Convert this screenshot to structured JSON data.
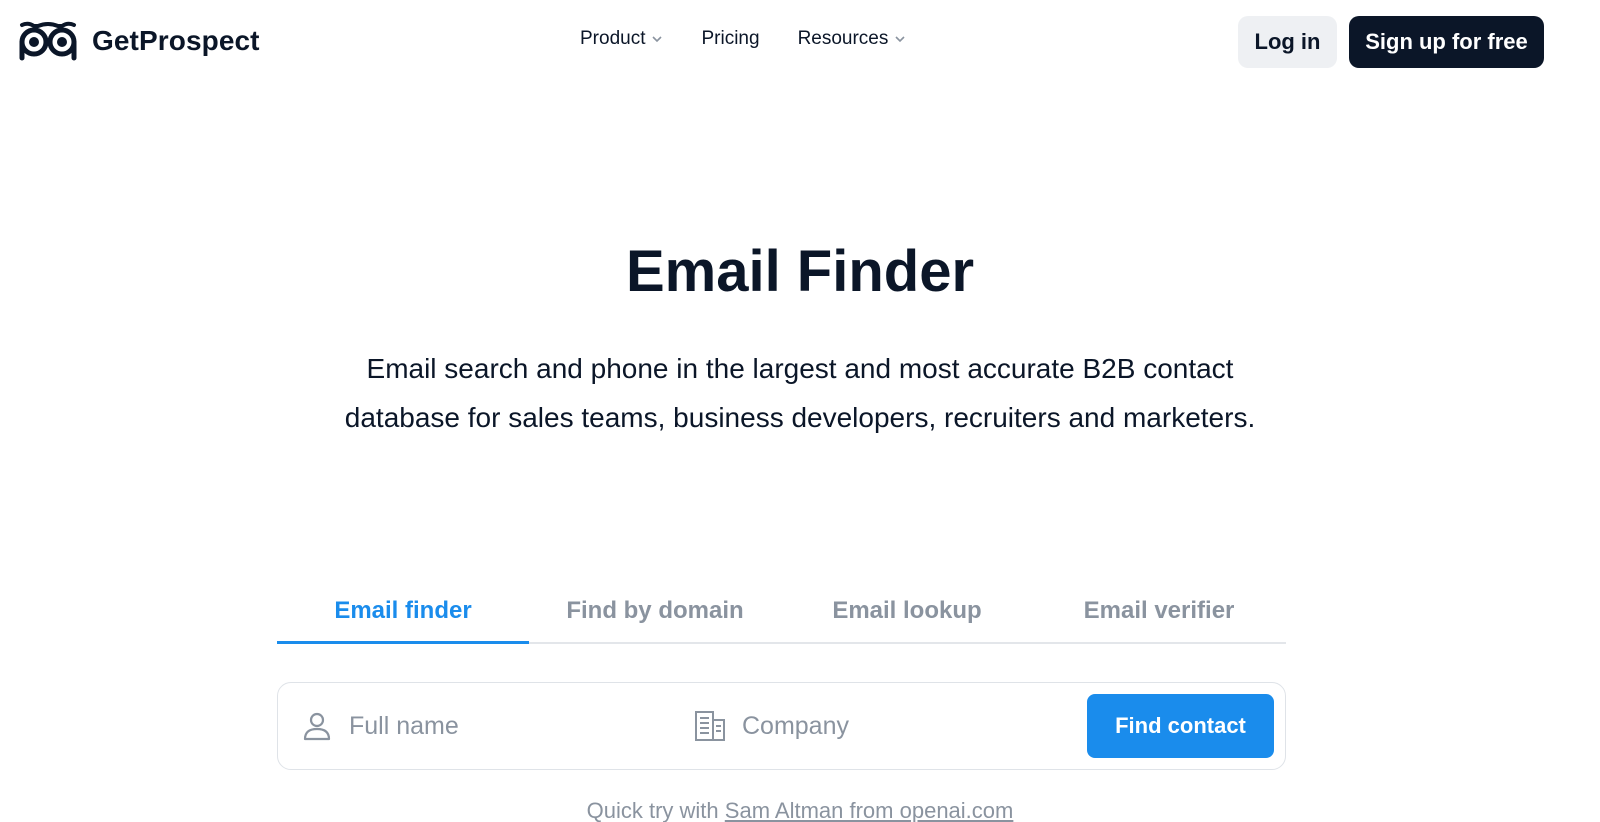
{
  "brand": {
    "name": "GetProspect"
  },
  "icons": {
    "logo": "owl-eyes-icon",
    "chevron": "chevron-down-icon",
    "person": "person-icon",
    "company": "building-icon"
  },
  "colors": {
    "brand_dark": "#0b1628",
    "accent": "#1a8cec",
    "muted": "#8a939f",
    "light_button": "#eef0f3"
  },
  "nav": {
    "items": [
      {
        "label": "Product",
        "has_dropdown": true
      },
      {
        "label": "Pricing",
        "has_dropdown": false
      },
      {
        "label": "Resources",
        "has_dropdown": true
      }
    ]
  },
  "auth": {
    "login_label": "Log in",
    "signup_label": "Sign up for free"
  },
  "hero": {
    "title": "Email Finder",
    "subtitle": "Email search and phone in the largest and most accurate B2B contact database for sales teams, business developers, recruiters and marketers."
  },
  "tabs": [
    {
      "label": "Email finder",
      "active": true
    },
    {
      "label": "Find by domain",
      "active": false
    },
    {
      "label": "Email lookup",
      "active": false
    },
    {
      "label": "Email verifier",
      "active": false
    }
  ],
  "search": {
    "name_placeholder": "Full name",
    "name_value": "",
    "company_placeholder": "Company",
    "company_value": "",
    "button_label": "Find contact"
  },
  "quick_try": {
    "prefix": "Quick try with",
    "link_label": "Sam Altman from openai.com"
  }
}
